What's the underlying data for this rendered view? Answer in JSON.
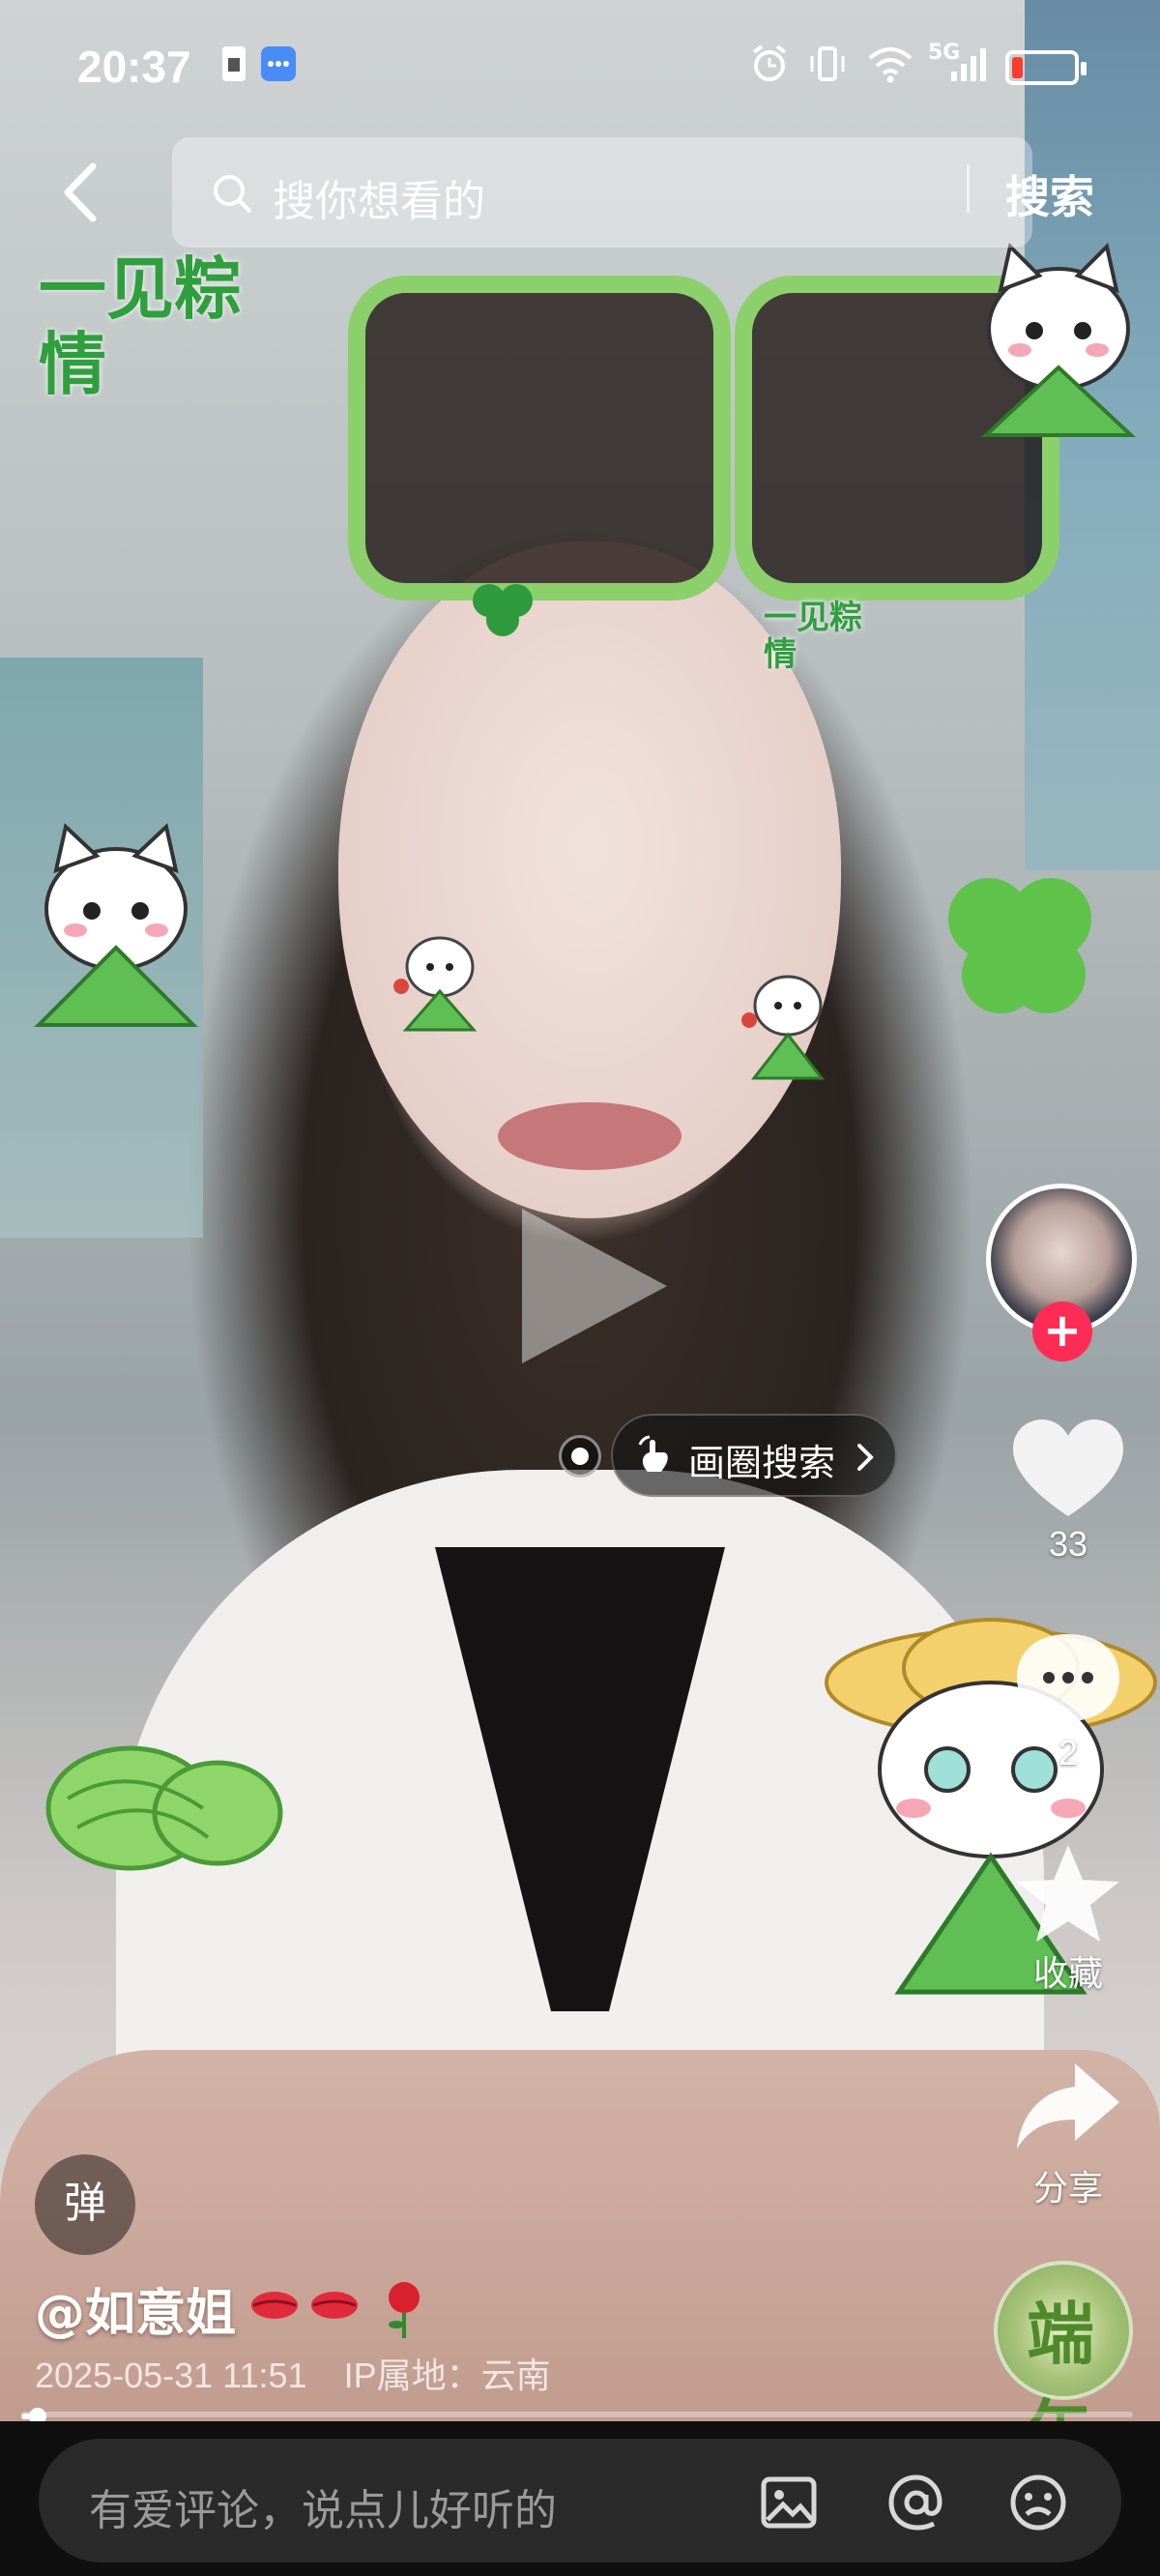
{
  "status_bar": {
    "time": "20:37",
    "network": "5G",
    "battery_level": 0.18,
    "icons": [
      "sim-icon",
      "message-bubble-icon",
      "alarm-icon",
      "vibrate-icon",
      "wifi-icon",
      "signal-icon",
      "battery-icon"
    ]
  },
  "top_bar": {
    "search_placeholder": "搜你想看的",
    "search_button": "搜索"
  },
  "video": {
    "sticker_text_left": "一见粽情",
    "sticker_text_face": "一见粽情"
  },
  "circle_search": {
    "label": "画圈搜索"
  },
  "side_actions": {
    "like_count": "33",
    "comment_count": "2",
    "favorite_label": "收藏",
    "share_label": "分享"
  },
  "danmu": {
    "label": "弹"
  },
  "author": {
    "name": "@如意姐",
    "date": "2025-05-31 11:51",
    "ip": "IP属地：云南"
  },
  "music_disc": {
    "text": "端午"
  },
  "progress": {
    "fraction": 0.01
  },
  "comment_bar": {
    "placeholder": "有爱评论，说点儿好听的"
  },
  "colors": {
    "accent": "#fe2c55",
    "sticker_green": "#8bd06b",
    "bottom_bar": "#0f0f0f"
  }
}
